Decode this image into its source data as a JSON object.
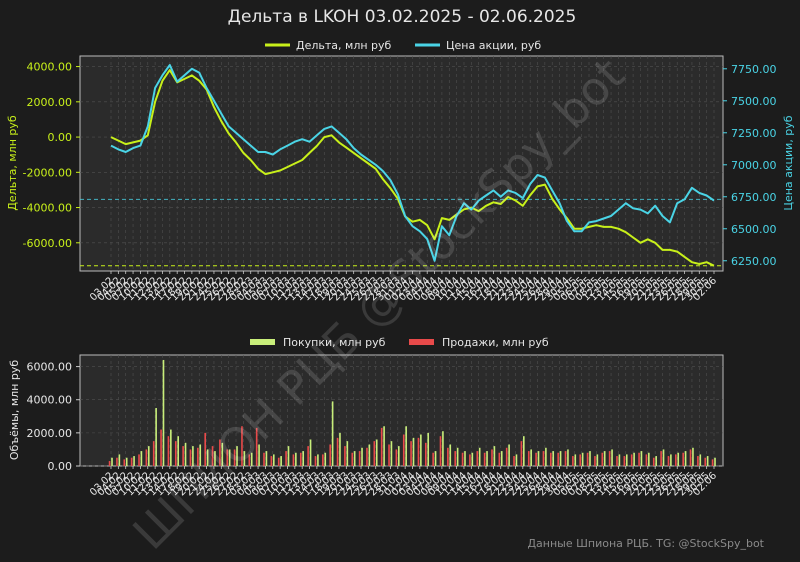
{
  "title": "Дельта в LKOH 03.02.2025 - 02.06.2025",
  "footer": "Данные Шпиона РЦБ. TG: @StockSpy_bot",
  "watermark": "ШПИОН РЦБ @StockSpy_bot",
  "colors": {
    "background": "#1c1c1c",
    "plot_bg": "#2b2b2b",
    "delta": "#c8f01a",
    "price": "#4ad4e6",
    "buy": "#c8ee7a",
    "sell": "#e84a4a",
    "text": "#e6e6e6",
    "grid": "#505050"
  },
  "chart_data": [
    {
      "type": "line",
      "legend_position": "top-center",
      "grid": true,
      "x_labels": [
        "03.02",
        "04.02",
        "05.02",
        "07.02",
        "10.02",
        "11.02",
        "12.02",
        "13.02",
        "14.02",
        "17.02",
        "18.02",
        "19.02",
        "20.02",
        "21.02",
        "24.02",
        "25.02",
        "26.02",
        "27.02",
        "28.02",
        "03.03",
        "04.03",
        "05.03",
        "06.03",
        "07.03",
        "10.03",
        "11.03",
        "12.03",
        "13.03",
        "14.03",
        "17.03",
        "18.03",
        "19.03",
        "20.03",
        "21.03",
        "24.03",
        "25.03",
        "26.03",
        "27.03",
        "28.03",
        "31.03",
        "01.04",
        "02.04",
        "03.04",
        "04.04",
        "07.04",
        "08.04",
        "09.04",
        "10.04",
        "11.04",
        "14.04",
        "15.04",
        "16.04",
        "17.04",
        "18.04",
        "21.04",
        "22.04",
        "23.04",
        "24.04",
        "25.04",
        "26.04",
        "28.04",
        "29.04",
        "30.04",
        "05.05",
        "06.05",
        "07.05",
        "08.05",
        "12.05",
        "13.05",
        "14.05",
        "15.05",
        "16.05",
        "19.05",
        "20.05",
        "21.05",
        "22.05",
        "23.05",
        "26.05",
        "27.05",
        "28.05",
        "29.05",
        "30.05",
        "02.06"
      ],
      "series": [
        {
          "name": "Дельта, млн руб",
          "axis": "left",
          "ylabel": "Дельта, млн руб",
          "ylim": [
            -7600,
            4600
          ],
          "yticks": [
            "4000.00",
            "2000.00",
            "0.00",
            "-2000.00",
            "-4000.00",
            "-6000.00"
          ],
          "values": [
            0,
            -200,
            -400,
            -300,
            -200,
            100,
            2000,
            3200,
            3800,
            3100,
            3300,
            3500,
            3200,
            2700,
            1700,
            900,
            200,
            -300,
            -900,
            -1300,
            -1800,
            -2100,
            -2000,
            -1900,
            -1700,
            -1500,
            -1300,
            -900,
            -500,
            0,
            100,
            -300,
            -600,
            -900,
            -1200,
            -1500,
            -1800,
            -2400,
            -2900,
            -3500,
            -4500,
            -4800,
            -4700,
            -5000,
            -5800,
            -4600,
            -4700,
            -4400,
            -4100,
            -4000,
            -4200,
            -3900,
            -3700,
            -3800,
            -3400,
            -3600,
            -3900,
            -3300,
            -2800,
            -2700,
            -3500,
            -4100,
            -4600,
            -5200,
            -5200,
            -5100,
            -5000,
            -5100,
            -5100,
            -5200,
            -5400,
            -5700,
            -6000,
            -5800,
            -6000,
            -6400,
            -6400,
            -6500,
            -6800,
            -7100,
            -7200,
            -7100,
            -7300
          ],
          "reference_line": -7300
        },
        {
          "name": "Цена акции, руб",
          "axis": "right",
          "ylabel": "Цена акции, руб",
          "ylim": [
            6170,
            7850
          ],
          "yticks": [
            "7750.00",
            "7500.00",
            "7250.00",
            "7000.00",
            "6750.00",
            "6500.00",
            "6250.00"
          ],
          "values": [
            7150,
            7120,
            7100,
            7130,
            7150,
            7300,
            7600,
            7700,
            7780,
            7650,
            7700,
            7750,
            7720,
            7600,
            7500,
            7400,
            7300,
            7250,
            7200,
            7150,
            7100,
            7100,
            7080,
            7120,
            7150,
            7180,
            7200,
            7180,
            7230,
            7280,
            7300,
            7250,
            7200,
            7130,
            7080,
            7040,
            7000,
            6950,
            6880,
            6770,
            6600,
            6520,
            6480,
            6420,
            6250,
            6520,
            6450,
            6600,
            6700,
            6650,
            6720,
            6760,
            6800,
            6750,
            6800,
            6780,
            6740,
            6850,
            6920,
            6900,
            6800,
            6700,
            6560,
            6480,
            6480,
            6550,
            6560,
            6580,
            6600,
            6650,
            6700,
            6660,
            6650,
            6620,
            6680,
            6600,
            6550,
            6700,
            6730,
            6820,
            6780,
            6760,
            6720
          ],
          "reference_line": 6730
        }
      ]
    },
    {
      "type": "bar",
      "legend_position": "top-center",
      "grid": true,
      "ylabel": "Объёмы, млн руб",
      "ylim": [
        0,
        6700
      ],
      "yticks": [
        "6000.00",
        "4000.00",
        "2000.00",
        "0.00"
      ],
      "series": [
        {
          "name": "Покупки, млн руб",
          "values": [
            500,
            700,
            500,
            600,
            900,
            1200,
            3500,
            6400,
            2200,
            1800,
            1400,
            1200,
            1300,
            1000,
            900,
            1400,
            1000,
            1200,
            900,
            800,
            1300,
            900,
            700,
            600,
            1200,
            800,
            900,
            1600,
            700,
            800,
            3900,
            2000,
            1500,
            900,
            1100,
            1300,
            1600,
            2400,
            1500,
            1200,
            2400,
            1700,
            1900,
            2000,
            900,
            2100,
            1300,
            1100,
            900,
            800,
            1100,
            900,
            1200,
            900,
            1300,
            700,
            1800,
            1000,
            900,
            1100,
            900,
            900,
            1000,
            700,
            800,
            900,
            700,
            900,
            1000,
            700,
            700,
            800,
            900,
            800,
            600,
            1000,
            700,
            800,
            900,
            1100,
            700,
            600,
            500
          ]
        },
        {
          "name": "Продажи, млн руб",
          "values": [
            300,
            500,
            400,
            500,
            700,
            1000,
            1500,
            2200,
            1800,
            1500,
            1200,
            1000,
            1100,
            2000,
            1200,
            1600,
            1000,
            1000,
            2400,
            700,
            2300,
            800,
            600,
            500,
            900,
            700,
            800,
            1200,
            600,
            700,
            1300,
            1700,
            1200,
            800,
            900,
            1100,
            1500,
            2300,
            1300,
            1000,
            1900,
            1500,
            1700,
            1400,
            800,
            1800,
            1100,
            900,
            800,
            700,
            900,
            800,
            1000,
            800,
            1100,
            600,
            1500,
            900,
            800,
            900,
            800,
            800,
            900,
            600,
            700,
            800,
            600,
            800,
            900,
            600,
            600,
            700,
            800,
            700,
            500,
            900,
            600,
            700,
            800,
            1000,
            600,
            500,
            400
          ]
        }
      ]
    }
  ]
}
